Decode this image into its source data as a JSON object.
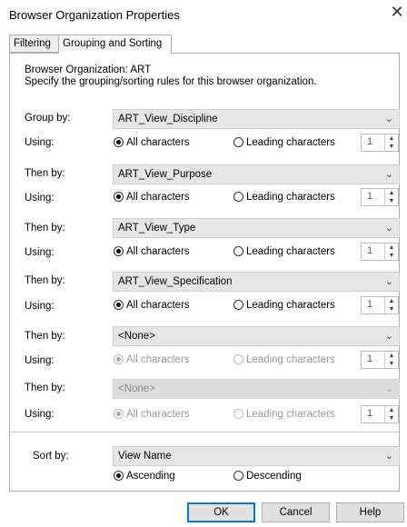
{
  "window": {
    "title": "Browser Organization Properties",
    "close_glyph": "✕"
  },
  "tabs": [
    {
      "label": "Filtering",
      "active": false
    },
    {
      "label": "Grouping and Sorting",
      "active": true
    }
  ],
  "intro": {
    "org_line": "Browser Organization: ART",
    "desc_line": "Specify the grouping/sorting rules for this browser organization."
  },
  "rules": [
    {
      "label": "Group by:",
      "value": "ART_View_Discipline",
      "using_label": "Using:",
      "all_label": "All characters",
      "leading_label": "Leading characters",
      "count": "1",
      "mode": "all",
      "enabled": true
    },
    {
      "label": "Then by:",
      "value": "ART_View_Purpose",
      "using_label": "Using:",
      "all_label": "All characters",
      "leading_label": "Leading characters",
      "count": "1",
      "mode": "all",
      "enabled": true
    },
    {
      "label": "Then by:",
      "value": "ART_View_Type",
      "using_label": "Using:",
      "all_label": "All characters",
      "leading_label": "Leading characters",
      "count": "1",
      "mode": "all",
      "enabled": true
    },
    {
      "label": "Then by:",
      "value": "ART_View_Specification",
      "using_label": "Using:",
      "all_label": "All characters",
      "leading_label": "Leading characters",
      "count": "1",
      "mode": "all",
      "enabled": true
    },
    {
      "label": "Then by:",
      "value": "<None>",
      "using_label": "Using:",
      "all_label": "All characters",
      "leading_label": "Leading characters",
      "count": "1",
      "mode": "all",
      "enabled": true,
      "using_enabled": false
    },
    {
      "label": "Then by:",
      "value": "<None>",
      "using_label": "Using:",
      "all_label": "All characters",
      "leading_label": "Leading characters",
      "count": "1",
      "mode": "all",
      "enabled": false,
      "using_enabled": false
    }
  ],
  "sort": {
    "label": "Sort by:",
    "value": "View Name",
    "ascending_label": "Ascending",
    "descending_label": "Descending",
    "order": "ascending"
  },
  "buttons": {
    "ok": "OK",
    "cancel": "Cancel",
    "help": "Help"
  },
  "icons": {
    "dropdown": "chevron-down-icon",
    "spinner": "spinner-arrows-icon"
  }
}
